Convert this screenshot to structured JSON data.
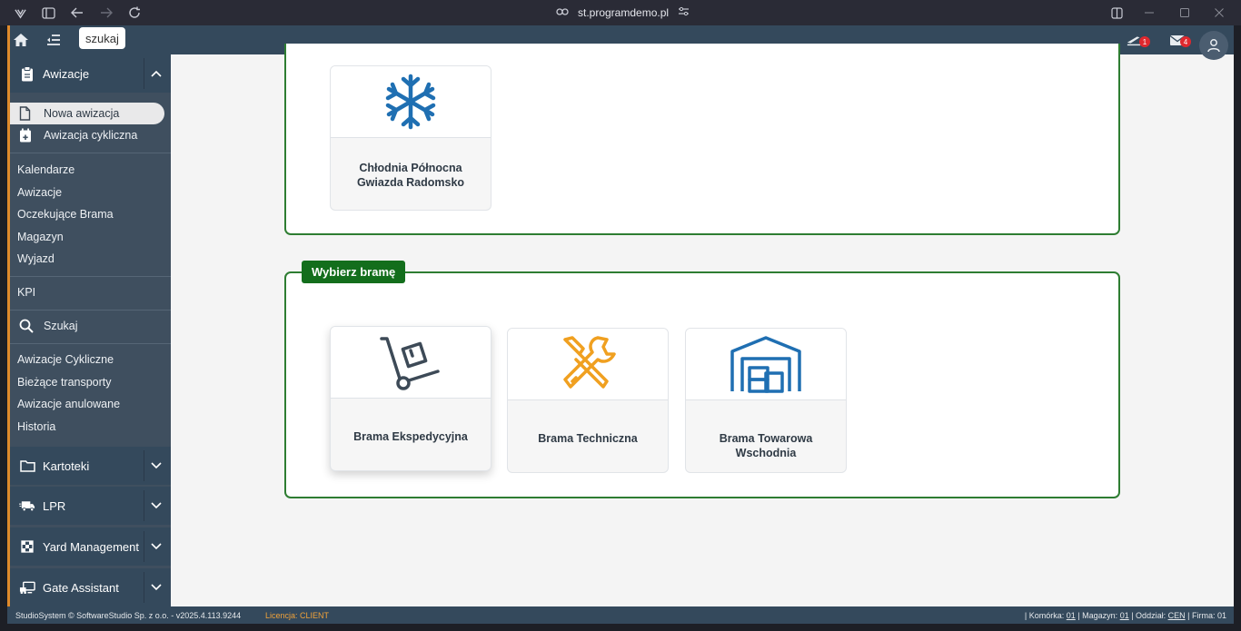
{
  "browser": {
    "url": "st.programdemo.pl"
  },
  "header": {
    "search_label": "szukaj",
    "notif_badge_1": "1",
    "notif_badge_2": "4"
  },
  "sidebar": {
    "awizacje": {
      "title": "Awizacje",
      "items": [
        "Nowa awizacja",
        "Awizacja cykliczna"
      ],
      "links": [
        "Kalendarze",
        "Awizacje",
        "Oczekujące Brama",
        "Magazyn",
        "Wyjazd"
      ]
    },
    "kpi": "KPI",
    "search": "Szukaj",
    "search_links": [
      "Awizacje Cykliczne",
      "Bieżące transporty",
      "Awizacje anulowane",
      "Historia"
    ],
    "sections": [
      "Kartoteki",
      "LPR",
      "Yard Management",
      "Gate Assistant"
    ]
  },
  "content": {
    "warehouse_tile": {
      "name": "Chłodnia Północna Gwiazda Radomsko"
    },
    "gate_panel_title": "Wybierz bramę",
    "gates": [
      {
        "name": "Brama Ekspedycyjna"
      },
      {
        "name": "Brama Techniczna"
      },
      {
        "name": "Brama Towarowa Wschodnia"
      }
    ]
  },
  "footer": {
    "copyright": "StudioSystem © SoftwareStudio Sp. z o.o. - v2025.4.113.9244",
    "license_label": "Licencja: CLIENT",
    "komorka_label": "| Komórka:",
    "komorka": "01",
    "magazyn_label": "| Magazyn:",
    "magazyn": "01",
    "oddzial_label": "| Oddział:",
    "oddzial": "CEN",
    "firma_label": "| Firma:",
    "firma": "01"
  },
  "colors": {
    "accent_green": "#136e1c",
    "header": "#34495c",
    "sidebar": "#3f4f5f",
    "accent_orange": "#e08a2b",
    "icon_blue": "#1f6fb2",
    "icon_orange": "#f0a020"
  }
}
